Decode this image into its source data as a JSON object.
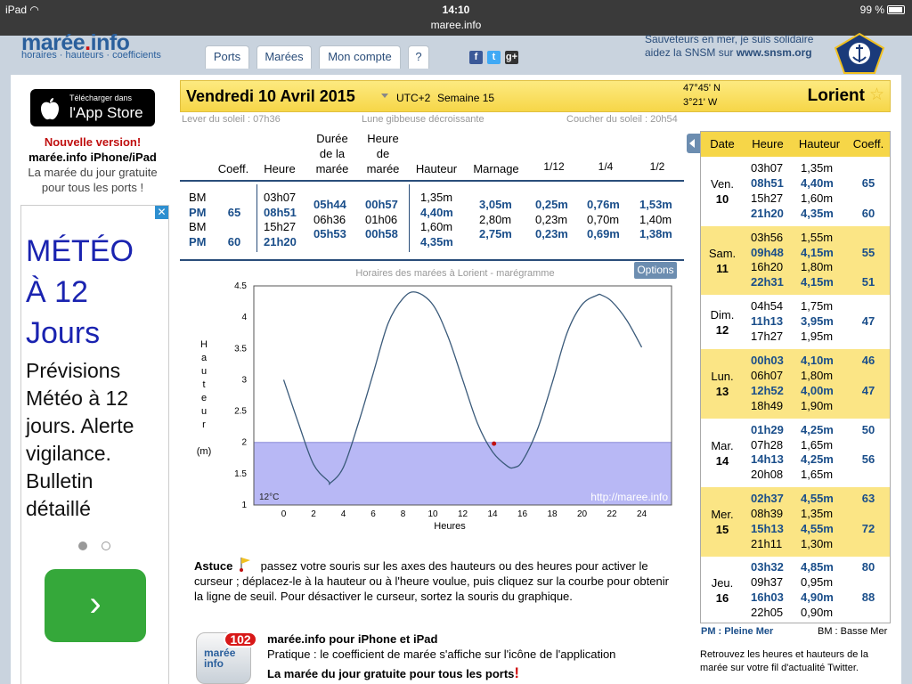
{
  "statusbar": {
    "device": "iPad",
    "time": "14:10",
    "url": "maree.info",
    "battery": "99 %"
  },
  "header": {
    "logo_a": "marée",
    "logo_b": "info",
    "logo_sub": "horaires · hauteurs · coefficients",
    "tabs": [
      "Ports",
      "Marées",
      "Mon compte",
      "?"
    ],
    "snsm_line1": "Sauveteurs en mer, je suis solidaire",
    "snsm_line2_a": "aidez la SNSM sur ",
    "snsm_line2_b": "www.snsm.org"
  },
  "left": {
    "app_small": "Télécharger dans",
    "app_big": "l'App Store",
    "new": "Nouvelle version!",
    "new_sub": "marée.info iPhone/iPad",
    "desc1": "La marée du jour gratuite",
    "desc2": "pour tous les ports !",
    "ad_headline": [
      "MÉTÉO",
      "À 12",
      "Jours"
    ],
    "ad_body": [
      "Prévisions",
      "Météo à 12",
      "jours. Alerte",
      "vigilance.",
      "Bulletin",
      "détaillé"
    ],
    "ad_close": "✕",
    "ad_go": "›"
  },
  "datebar": {
    "date": "Vendredi 10 Avril 2015",
    "tz": "UTC+2",
    "week": "Semaine 15",
    "lat": "47°45' N",
    "lon": "3°21' W",
    "city": "Lorient"
  },
  "sun": {
    "rise": "Lever du soleil : 07h36",
    "moon": "Lune gibbeuse décroissante",
    "set": "Coucher du soleil : 20h54"
  },
  "table": {
    "headers": {
      "coeff": "Coeff.",
      "heure": "Heure",
      "duree": [
        "Durée",
        "de la",
        "marée"
      ],
      "hmaree": [
        "Heure",
        "de",
        "marée"
      ],
      "hauteur": "Hauteur",
      "marnage": "Marnage",
      "f12": "1/12",
      "f14": "1/4",
      "f12b": "1/2"
    },
    "col_type": [
      "BM",
      "PM",
      "BM",
      "PM"
    ],
    "col_coeff": [
      "",
      "65",
      "",
      "60"
    ],
    "col_heure": [
      "03h07",
      "08h51",
      "15h27",
      "21h20"
    ],
    "col_duree": [
      "05h44",
      "06h36",
      "05h53"
    ],
    "col_hmaree": [
      "00h57",
      "01h06",
      "00h58"
    ],
    "col_hauteur": [
      "1,35m",
      "4,40m",
      "1,60m",
      "4,35m"
    ],
    "col_marnage": [
      "3,05m",
      "2,80m",
      "2,75m"
    ],
    "col_f12": [
      "0,25m",
      "0,23m",
      "0,23m"
    ],
    "col_f14": [
      "0,76m",
      "0,70m",
      "0,69m"
    ],
    "col_f2": [
      "1,53m",
      "1,40m",
      "1,38m"
    ]
  },
  "chart": {
    "title": "Horaires des marées à Lorient - marégramme",
    "options": "Options",
    "temp": "12°C",
    "watermark": "http://maree.info",
    "ylabel_letters": [
      "H",
      "a",
      "u",
      "t",
      "e",
      "u",
      "r"
    ],
    "yunit": "(m)",
    "xlabel": "Heures"
  },
  "chart_data": {
    "type": "line",
    "xlabel": "Heures",
    "ylabel": "Hauteur (m)",
    "xlim": [
      -2,
      26
    ],
    "ylim": [
      1,
      4.5
    ],
    "xticks": [
      0,
      2,
      4,
      6,
      8,
      10,
      12,
      14,
      16,
      18,
      20,
      22,
      24
    ],
    "yticks": [
      1,
      1.5,
      2,
      2.5,
      3,
      3.5,
      4,
      4.5
    ],
    "x": [
      0,
      1,
      2,
      3,
      3.12,
      4,
      5,
      6,
      7,
      8,
      8.85,
      10,
      11,
      12,
      13,
      14,
      15,
      15.45,
      16,
      17,
      18,
      19,
      20,
      21,
      21.33,
      22,
      23,
      24
    ],
    "y": [
      3.0,
      2.3,
      1.65,
      1.38,
      1.35,
      1.6,
      2.3,
      3.1,
      3.9,
      4.3,
      4.4,
      4.2,
      3.7,
      3.0,
      2.3,
      1.85,
      1.62,
      1.6,
      1.7,
      2.2,
      2.95,
      3.75,
      4.2,
      4.35,
      4.35,
      4.25,
      3.95,
      3.52
    ],
    "threshold": 2.0,
    "cursor": {
      "x": 14.1,
      "y": 1.98
    },
    "line_color": "#3a5a7a",
    "fill_color": "#b8b8f5",
    "grid": false
  },
  "astuce": {
    "label": "Astuce",
    "text": "passez votre souris sur les axes des hauteurs ou des heures pour activer le curseur ; déplacez-le à la hauteur ou à l'heure voulue, puis cliquez sur la courbe pour obtenir la ligne de seuil. Pour désactiver le curseur, sortez la souris du graphique."
  },
  "app": {
    "title": "marée.info pour iPhone et iPad",
    "line": "Pratique : le coefficient de marée s'affiche sur l'icône de l'application",
    "line2": "La marée du jour gratuite pour tous les ports",
    "excl": "!",
    "badge": "102",
    "icon_l1": "marée",
    "icon_l2": "info"
  },
  "side": {
    "headers": [
      "Date",
      "Heure",
      "Hauteur",
      "Coeff."
    ],
    "days": [
      {
        "d1": "Ven.",
        "d2": "10",
        "heures": [
          "03h07",
          "08h51",
          "15h27",
          "21h20"
        ],
        "hauteurs": [
          "1,35m",
          "4,40m",
          "1,60m",
          "4,35m"
        ],
        "coeffs": [
          "",
          "65",
          "",
          "60"
        ],
        "pm": [
          false,
          true,
          false,
          true
        ]
      },
      {
        "d1": "Sam.",
        "d2": "11",
        "heures": [
          "03h56",
          "09h48",
          "16h20",
          "22h31"
        ],
        "hauteurs": [
          "1,55m",
          "4,15m",
          "1,80m",
          "4,15m"
        ],
        "coeffs": [
          "",
          "55",
          "",
          "51"
        ],
        "pm": [
          false,
          true,
          false,
          true
        ]
      },
      {
        "d1": "Dim.",
        "d2": "12",
        "heures": [
          "04h54",
          "11h13",
          "17h27"
        ],
        "hauteurs": [
          "1,75m",
          "3,95m",
          "1,95m"
        ],
        "coeffs": [
          "",
          "47",
          ""
        ],
        "pm": [
          false,
          true,
          false
        ]
      },
      {
        "d1": "Lun.",
        "d2": "13",
        "heures": [
          "00h03",
          "06h07",
          "12h52",
          "18h49"
        ],
        "hauteurs": [
          "4,10m",
          "1,80m",
          "4,00m",
          "1,90m"
        ],
        "coeffs": [
          "46",
          "",
          "47",
          ""
        ],
        "pm": [
          true,
          false,
          true,
          false
        ]
      },
      {
        "d1": "Mar.",
        "d2": "14",
        "heures": [
          "01h29",
          "07h28",
          "14h13",
          "20h08"
        ],
        "hauteurs": [
          "4,25m",
          "1,65m",
          "4,25m",
          "1,65m"
        ],
        "coeffs": [
          "50",
          "",
          "56",
          ""
        ],
        "pm": [
          true,
          false,
          true,
          false
        ]
      },
      {
        "d1": "Mer.",
        "d2": "15",
        "heures": [
          "02h37",
          "08h39",
          "15h13",
          "21h11"
        ],
        "hauteurs": [
          "4,55m",
          "1,35m",
          "4,55m",
          "1,30m"
        ],
        "coeffs": [
          "63",
          "",
          "72",
          ""
        ],
        "pm": [
          true,
          false,
          true,
          false
        ]
      },
      {
        "d1": "Jeu.",
        "d2": "16",
        "heures": [
          "03h32",
          "09h37",
          "16h03",
          "22h05"
        ],
        "hauteurs": [
          "4,85m",
          "0,95m",
          "4,90m",
          "0,90m"
        ],
        "coeffs": [
          "80",
          "",
          "88",
          ""
        ],
        "pm": [
          true,
          false,
          true,
          false
        ]
      }
    ],
    "legend_pm": "PM : Pleine Mer",
    "legend_bm": "BM : Basse Mer",
    "retro1": "Retrouvez les heures et hauteurs de la",
    "retro2": "marée sur votre fil d'actualité Twitter."
  },
  "colors": {
    "yellow": "#f6d648",
    "navy": "#1a4e8a",
    "red": "#d01010"
  }
}
